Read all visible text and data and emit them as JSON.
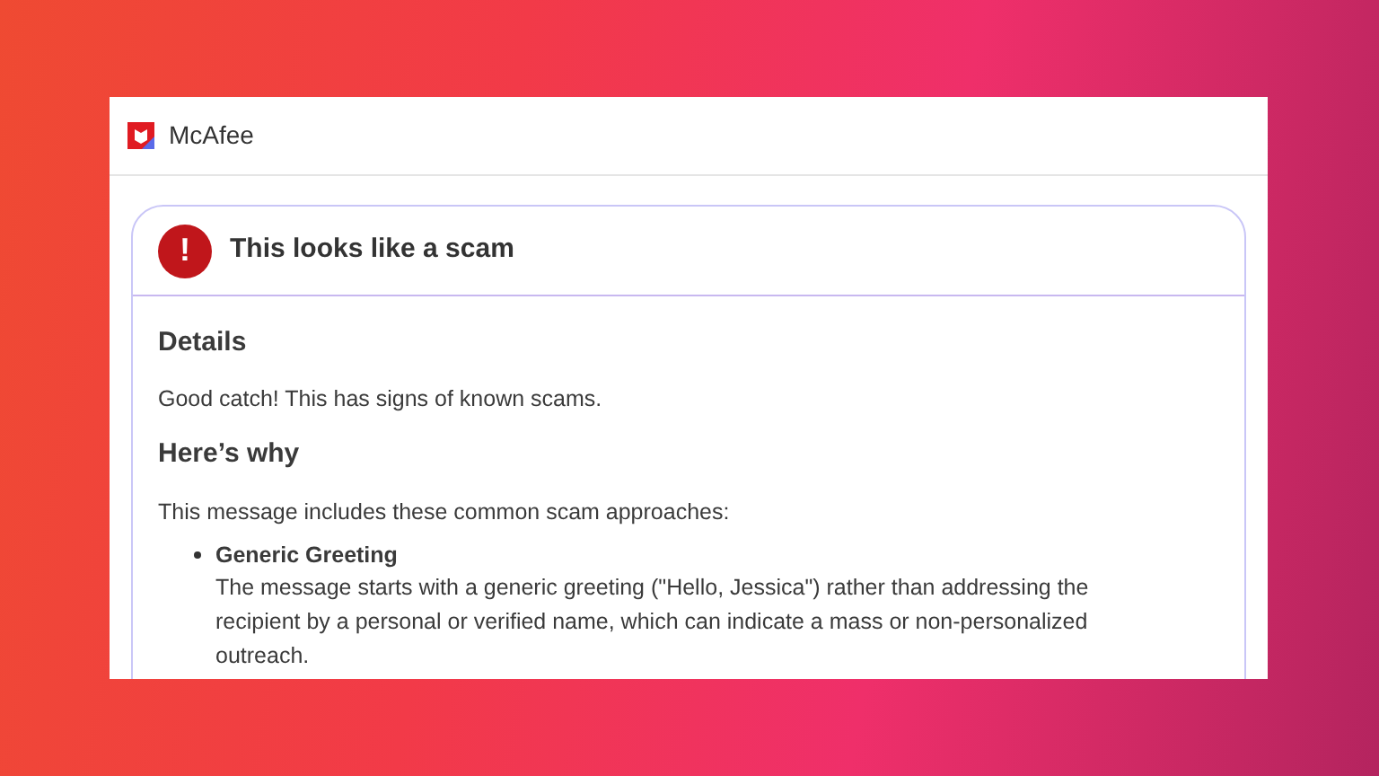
{
  "window": {
    "title": "McAfee"
  },
  "alert": {
    "title": "This looks like a scam",
    "icon_text": "!"
  },
  "details": {
    "heading": "Details",
    "text": "Good catch! This has signs of known scams."
  },
  "why": {
    "heading": "Here’s why",
    "intro": "This message includes these common scam approaches:",
    "items": [
      {
        "title": "Generic Greeting",
        "text": "The message starts with a generic greeting (\"Hello, Jessica\") rather than addressing the recipient by a personal or verified name, which can indicate a mass or non-personalized outreach."
      }
    ]
  }
}
